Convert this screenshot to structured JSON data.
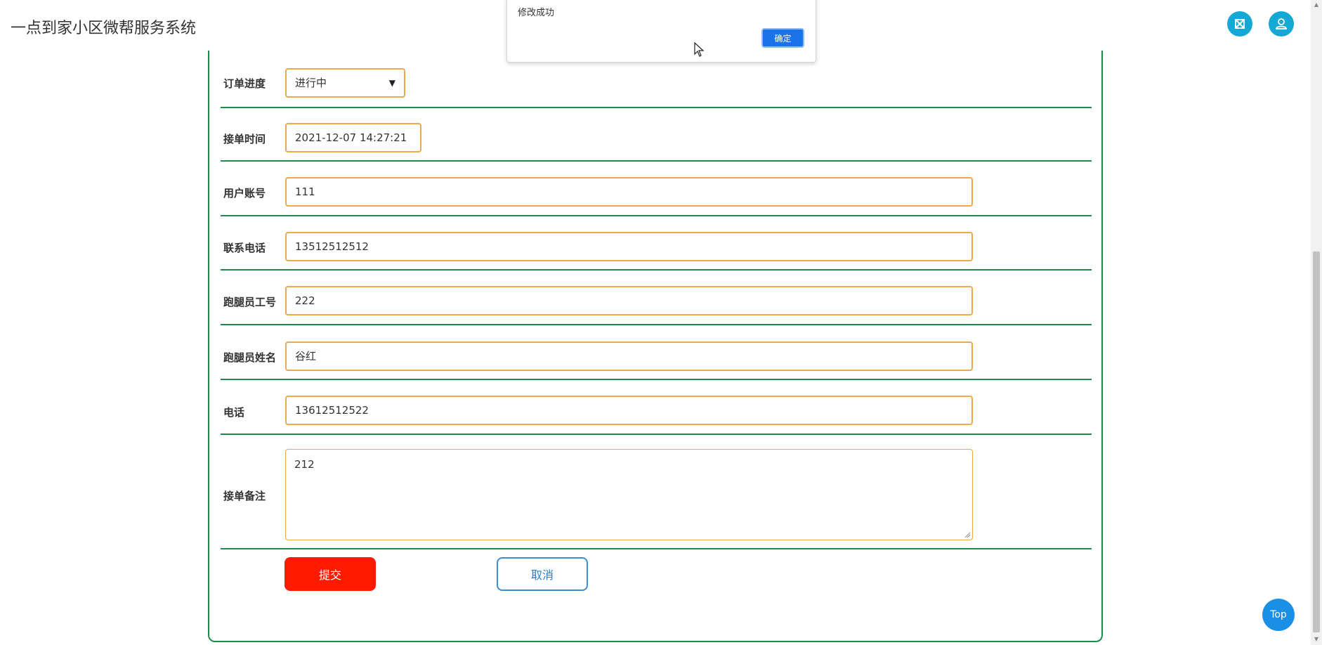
{
  "app": {
    "title": "一点到家小区微帮服务系统"
  },
  "dialog": {
    "message": "修改成功",
    "ok_label": "确定"
  },
  "form": {
    "order_progress": {
      "label": "订单进度",
      "value": "进行中"
    },
    "accept_time": {
      "label": "接单时间",
      "value": "2021-12-07 14:27:21"
    },
    "user_account": {
      "label": "用户账号",
      "value": "111"
    },
    "contact_phone": {
      "label": "联系电话",
      "value": "13512512512"
    },
    "runner_id": {
      "label": "跑腿员工号",
      "value": "222"
    },
    "runner_name": {
      "label": "跑腿员姓名",
      "value": "谷红"
    },
    "phone": {
      "label": "电话",
      "value": "13612512522"
    },
    "accept_note": {
      "label": "接单备注",
      "value": "212"
    }
  },
  "actions": {
    "submit_label": "提交",
    "cancel_label": "取消",
    "top_label": "Top"
  },
  "colors": {
    "accent": "#14a8d4",
    "form_border": "#1f8a4c",
    "field_border": "#f0a84a",
    "submit": "#ff1a00",
    "cancel": "#3a8fd9",
    "dialog_ok": "#1a73e8"
  },
  "icons": {
    "expand": "expand-arrows-icon",
    "user": "user-icon",
    "dropdown": "chevron-down-icon",
    "cursor": "mouse-pointer-icon"
  }
}
